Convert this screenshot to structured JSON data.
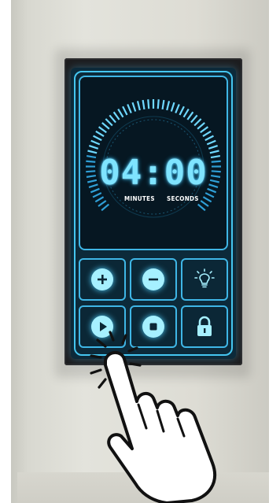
{
  "timer": {
    "time": "04:00",
    "unit_minutes": "MINUTES",
    "unit_seconds": "SECONDS"
  },
  "buttons": [
    {
      "name": "plus-button",
      "icon": "plus-icon"
    },
    {
      "name": "minus-button",
      "icon": "minus-icon"
    },
    {
      "name": "light-button",
      "icon": "lightbulb-icon"
    },
    {
      "name": "play-button",
      "icon": "play-icon"
    },
    {
      "name": "stop-button",
      "icon": "stop-icon"
    },
    {
      "name": "lock-button",
      "icon": "lock-icon"
    }
  ],
  "colors": {
    "accent": "#45c6f0",
    "glow": "#7fe4ff",
    "screen_bg": "#0c2a3a"
  }
}
